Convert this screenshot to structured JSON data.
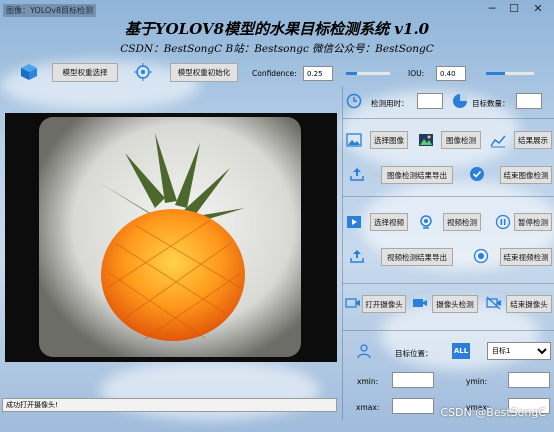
{
  "window": {
    "title": "图像：YOLOv8目标检测"
  },
  "header": {
    "title": "基于YOLOV8模型的水果目标检测系统 v1.0",
    "subtitle": "CSDN：BestSongC   B站：Bestsongc   微信公众号：BestSongC"
  },
  "toolbar": {
    "select_weights": "模型权重选择",
    "init_weights": "模型权重初始化",
    "confidence_label": "Confidence:",
    "confidence_value": "0.25",
    "confidence_level": 0.25,
    "iou_label": "IOU:",
    "iou_value": "0.40",
    "iou_level": 0.4
  },
  "stats": {
    "time_label": "检测用时：",
    "time_value": "",
    "count_label": "目标数量：",
    "count_value": ""
  },
  "image_section": {
    "select_image": "选择图像",
    "detect_image": "图像检测",
    "show_result": "结果展示",
    "export_image": "图像检测结果导出",
    "stop_image": "结束图像检测"
  },
  "video_section": {
    "select_video": "选择视频",
    "detect_video": "视频检测",
    "pause_detect": "暂停检测",
    "export_video": "视频检测结果导出",
    "stop_video": "结束视频检测"
  },
  "camera_section": {
    "open_camera": "打开摄像头",
    "detect_camera": "摄像头检测",
    "stop_camera": "结束摄像头"
  },
  "target_section": {
    "position_label": "目标位置：",
    "all_badge": "ALL",
    "target_option": "目标1",
    "xmin_label": "xmin:",
    "ymin_label": "ymin:",
    "xmax_label": "xmax:",
    "ymax_label": "ymax:",
    "xmin_value": "",
    "ymin_value": "",
    "xmax_value": "",
    "ymax_value": ""
  },
  "status": {
    "message": "成功打开摄像头!"
  },
  "watermark": "CSDN @BestSongC",
  "colors": {
    "accent": "#2a7fd8",
    "button_bg": "#e1e1e1"
  }
}
